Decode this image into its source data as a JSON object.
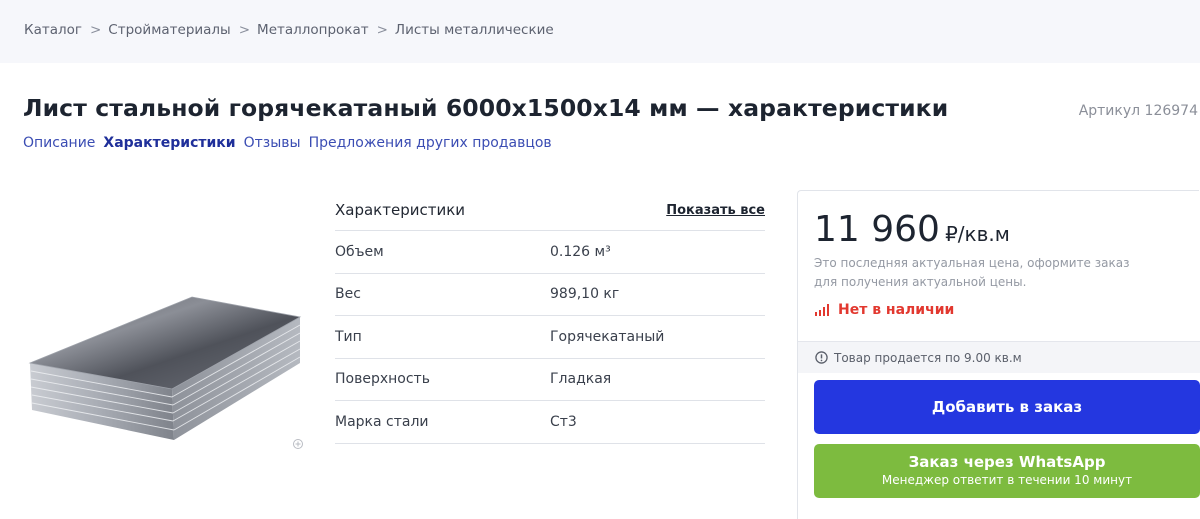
{
  "breadcrumb": {
    "items": [
      "Каталог",
      "Стройматериалы",
      "Металлопрокат",
      "Листы металлические"
    ],
    "separator": ">"
  },
  "product": {
    "title": "Лист стальной горячекатаный 6000х1500х14 мм — характеристики",
    "sku": "Артикул 126974"
  },
  "tabs": [
    {
      "label": "Описание",
      "active": false
    },
    {
      "label": "Характеристики",
      "active": true
    },
    {
      "label": "Отзывы",
      "active": false
    },
    {
      "label": "Предложения других продавцов",
      "active": false
    }
  ],
  "specs": {
    "title": "Характеристики",
    "show_all": "Показать все",
    "rows": [
      {
        "name": "Объем",
        "value": "0.126 м³"
      },
      {
        "name": "Вес",
        "value": "989,10 кг"
      },
      {
        "name": "Тип",
        "value": "Горячекатаный"
      },
      {
        "name": "Поверхность",
        "value": "Гладкая"
      },
      {
        "name": "Марка стали",
        "value": "Ст3"
      }
    ]
  },
  "purchase": {
    "price": "11 960",
    "currency_unit": "₽/кв.м",
    "price_note": "Это последняя актуальная цена, оформите заказ для получения актуальной цены.",
    "stock_status": "Нет в наличии",
    "qty_note": "Товар продается по 9.00 кв.м",
    "add_to_order": "Добавить в заказ",
    "whatsapp_title": "Заказ через WhatsApp",
    "whatsapp_subtitle": "Менеджер ответит в течении 10 минут"
  },
  "colors": {
    "primary_button": "#2437e0",
    "whatsapp_button": "#7dbb3f",
    "out_of_stock": "#e2382f",
    "link": "#3b4db3"
  },
  "icons": {
    "stock": "signal-bars-icon",
    "info": "info-circle-icon",
    "zoom": "zoom-icon"
  }
}
